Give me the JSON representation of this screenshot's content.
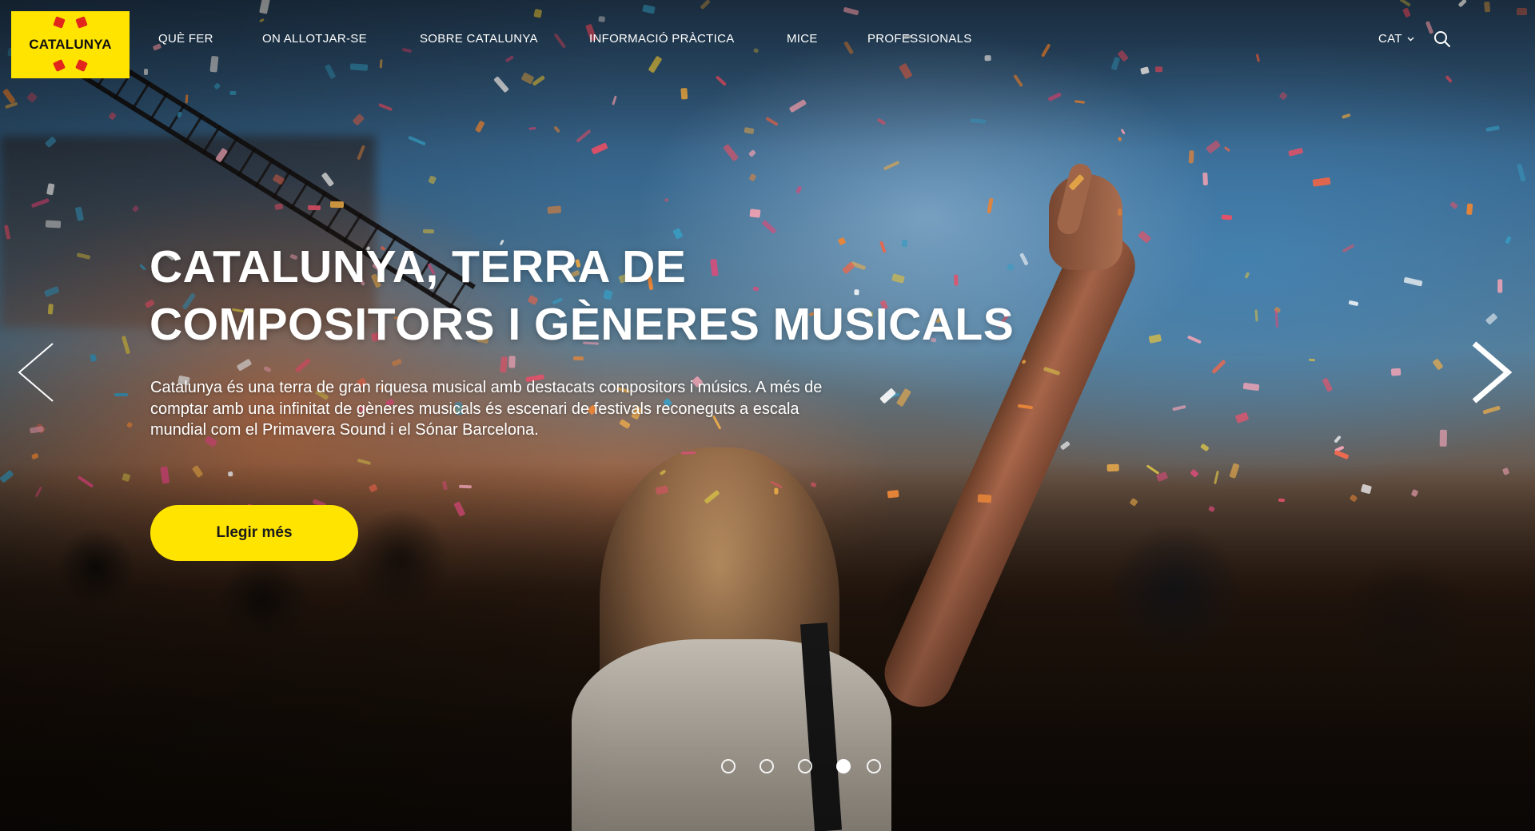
{
  "brand": {
    "logo_text": "CATALUNYA",
    "accent_color": "#ffe400",
    "logo_mark_color": "#e2261b"
  },
  "nav": {
    "items": [
      {
        "label": "QUÈ FER"
      },
      {
        "label": "ON ALLOTJAR-SE"
      },
      {
        "label": "SOBRE CATALUNYA"
      },
      {
        "label": "INFORMACIÓ PRÀCTICA"
      },
      {
        "label": "MICE"
      },
      {
        "label": "PROFESSIONALS"
      }
    ],
    "language": "CAT",
    "language_icon": "chevron-down-icon",
    "search_icon": "search-icon"
  },
  "hero": {
    "title_line1": "CATALUNYA, TERRA DE",
    "title_line2": "COMPOSITORS I GÈNERES MUSICALS",
    "description": "Catalunya és una terra de gran riquesa musical amb destacats compositors i músics. A més de comptar amb una infinitat de gèneres musicals és escenari de festivals reconeguts a escala mundial com el Primavera Sound i el Sónar Barcelona.",
    "cta_label": "Llegir més",
    "prev_icon": "chevron-left-icon",
    "next_icon": "chevron-right-icon"
  },
  "carousel": {
    "slide_count": 5,
    "active_slide": 4
  }
}
